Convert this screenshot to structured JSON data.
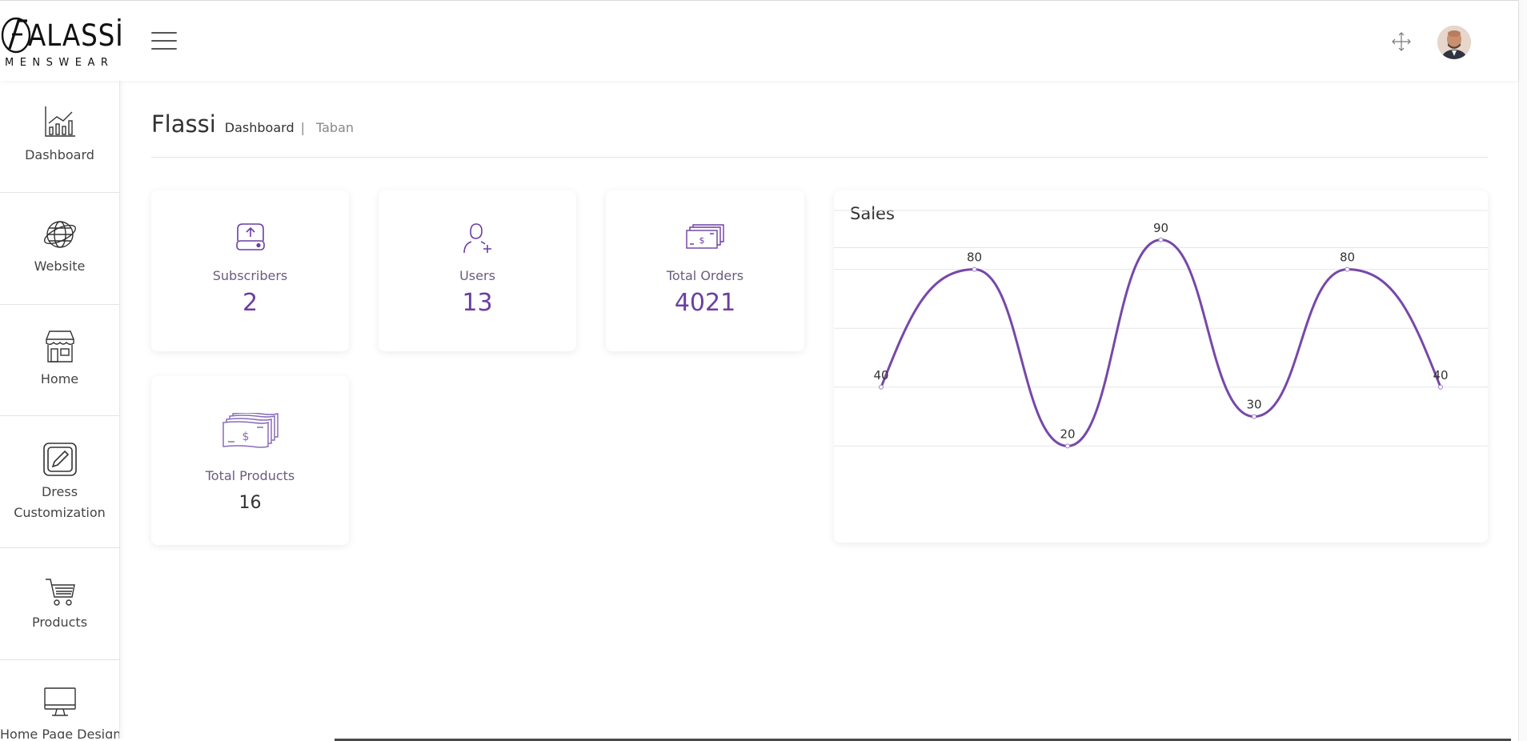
{
  "brand": {
    "logo_text": "ALASSİ",
    "logo_sub": "MENSWEAR"
  },
  "header": {
    "menu_icon": "hamburger-icon",
    "fullscreen_icon": "expand-arrows-icon",
    "avatar": "user-avatar"
  },
  "sidebar": {
    "items": [
      {
        "label": "Dashboard",
        "icon": "chart-bars-icon"
      },
      {
        "label": "Website",
        "icon": "globe-icon"
      },
      {
        "label": "Home",
        "icon": "storefront-icon"
      },
      {
        "label": "Dress Customization",
        "icon": "edit-pencil-icon"
      },
      {
        "label": "Products",
        "icon": "shopping-cart-icon"
      },
      {
        "label": "Home Page Design",
        "icon": "monitor-icon"
      }
    ]
  },
  "breadcrumb": {
    "title": "Flassi",
    "active": "Dashboard",
    "separator": "|",
    "link": "Taban"
  },
  "stats": [
    {
      "label": "Subscribers",
      "value": "2",
      "icon": "upload-drive-icon"
    },
    {
      "label": "Users",
      "value": "13",
      "icon": "add-user-icon"
    },
    {
      "label": "Total Orders",
      "value": "4021",
      "icon": "cash-stack-icon"
    },
    {
      "label": "Total Products",
      "value": "16",
      "icon": "cash-stack-icon"
    }
  ],
  "sales": {
    "title": "Sales"
  },
  "chart_data": {
    "type": "line",
    "title": "Sales",
    "x": [
      1,
      2,
      3,
      4,
      5,
      6,
      7
    ],
    "series": [
      {
        "values": [
          40,
          80,
          20,
          90,
          30,
          80,
          40
        ]
      }
    ],
    "ylim": [
      0,
      100
    ],
    "grid": true,
    "data_labels": [
      "40",
      "80",
      "20",
      "90",
      "30",
      "80",
      "40"
    ],
    "colors": {
      "line": "#7748a8"
    }
  },
  "colors": {
    "accent": "#6b3fa0",
    "label": "#6b5b80"
  }
}
